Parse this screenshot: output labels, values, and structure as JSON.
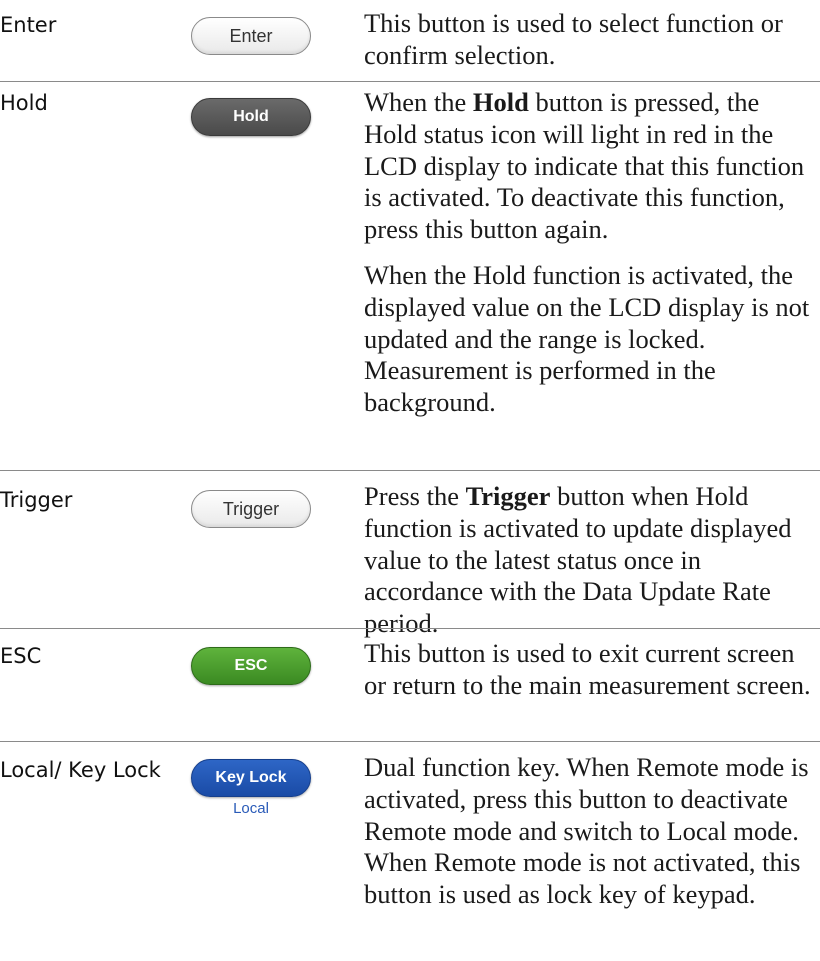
{
  "rows": [
    {
      "name": "Enter",
      "button_label": "Enter",
      "description": "This button is used to select function or confirm selection."
    },
    {
      "name": "Hold",
      "button_label": "Hold",
      "desc_p1_before": "When the ",
      "desc_p1_bold": "Hold",
      "desc_p1_after": " button is pressed, the Hold status icon will light in red in the LCD display to indicate that this function is activated. To deactivate this function, press this button again.",
      "desc_p2": "When the Hold function is activated, the displayed value on the LCD display is not updated and the range is locked. Measurement is performed in the background."
    },
    {
      "name": "Trigger",
      "button_label": "Trigger",
      "desc_before": "Press the ",
      "desc_bold": "Trigger",
      "desc_after": " button when Hold function is activated to update displayed value to the latest status once in accordance with the Data Update Rate period."
    },
    {
      "name": "ESC",
      "button_label": "ESC",
      "description": "This button is used to exit current screen or return to the main measurement screen."
    },
    {
      "name": "Local/ Key Lock",
      "button_label": "Key Lock",
      "button_sublabel": "Local",
      "description": "Dual function key. When Remote mode is activated, press this button to deactivate Remote mode and switch to Local mode. When Remote mode is not activated, this button is used as lock key of keypad."
    }
  ],
  "colors": {
    "enter_button": "#f2f2f2",
    "hold_button": "#555555",
    "trigger_button": "#f2f2f2",
    "esc_button": "#4a9d2e",
    "keylock_button": "#1f55b3",
    "local_label": "#2a5bb8",
    "separator": "#8a8a8a"
  }
}
